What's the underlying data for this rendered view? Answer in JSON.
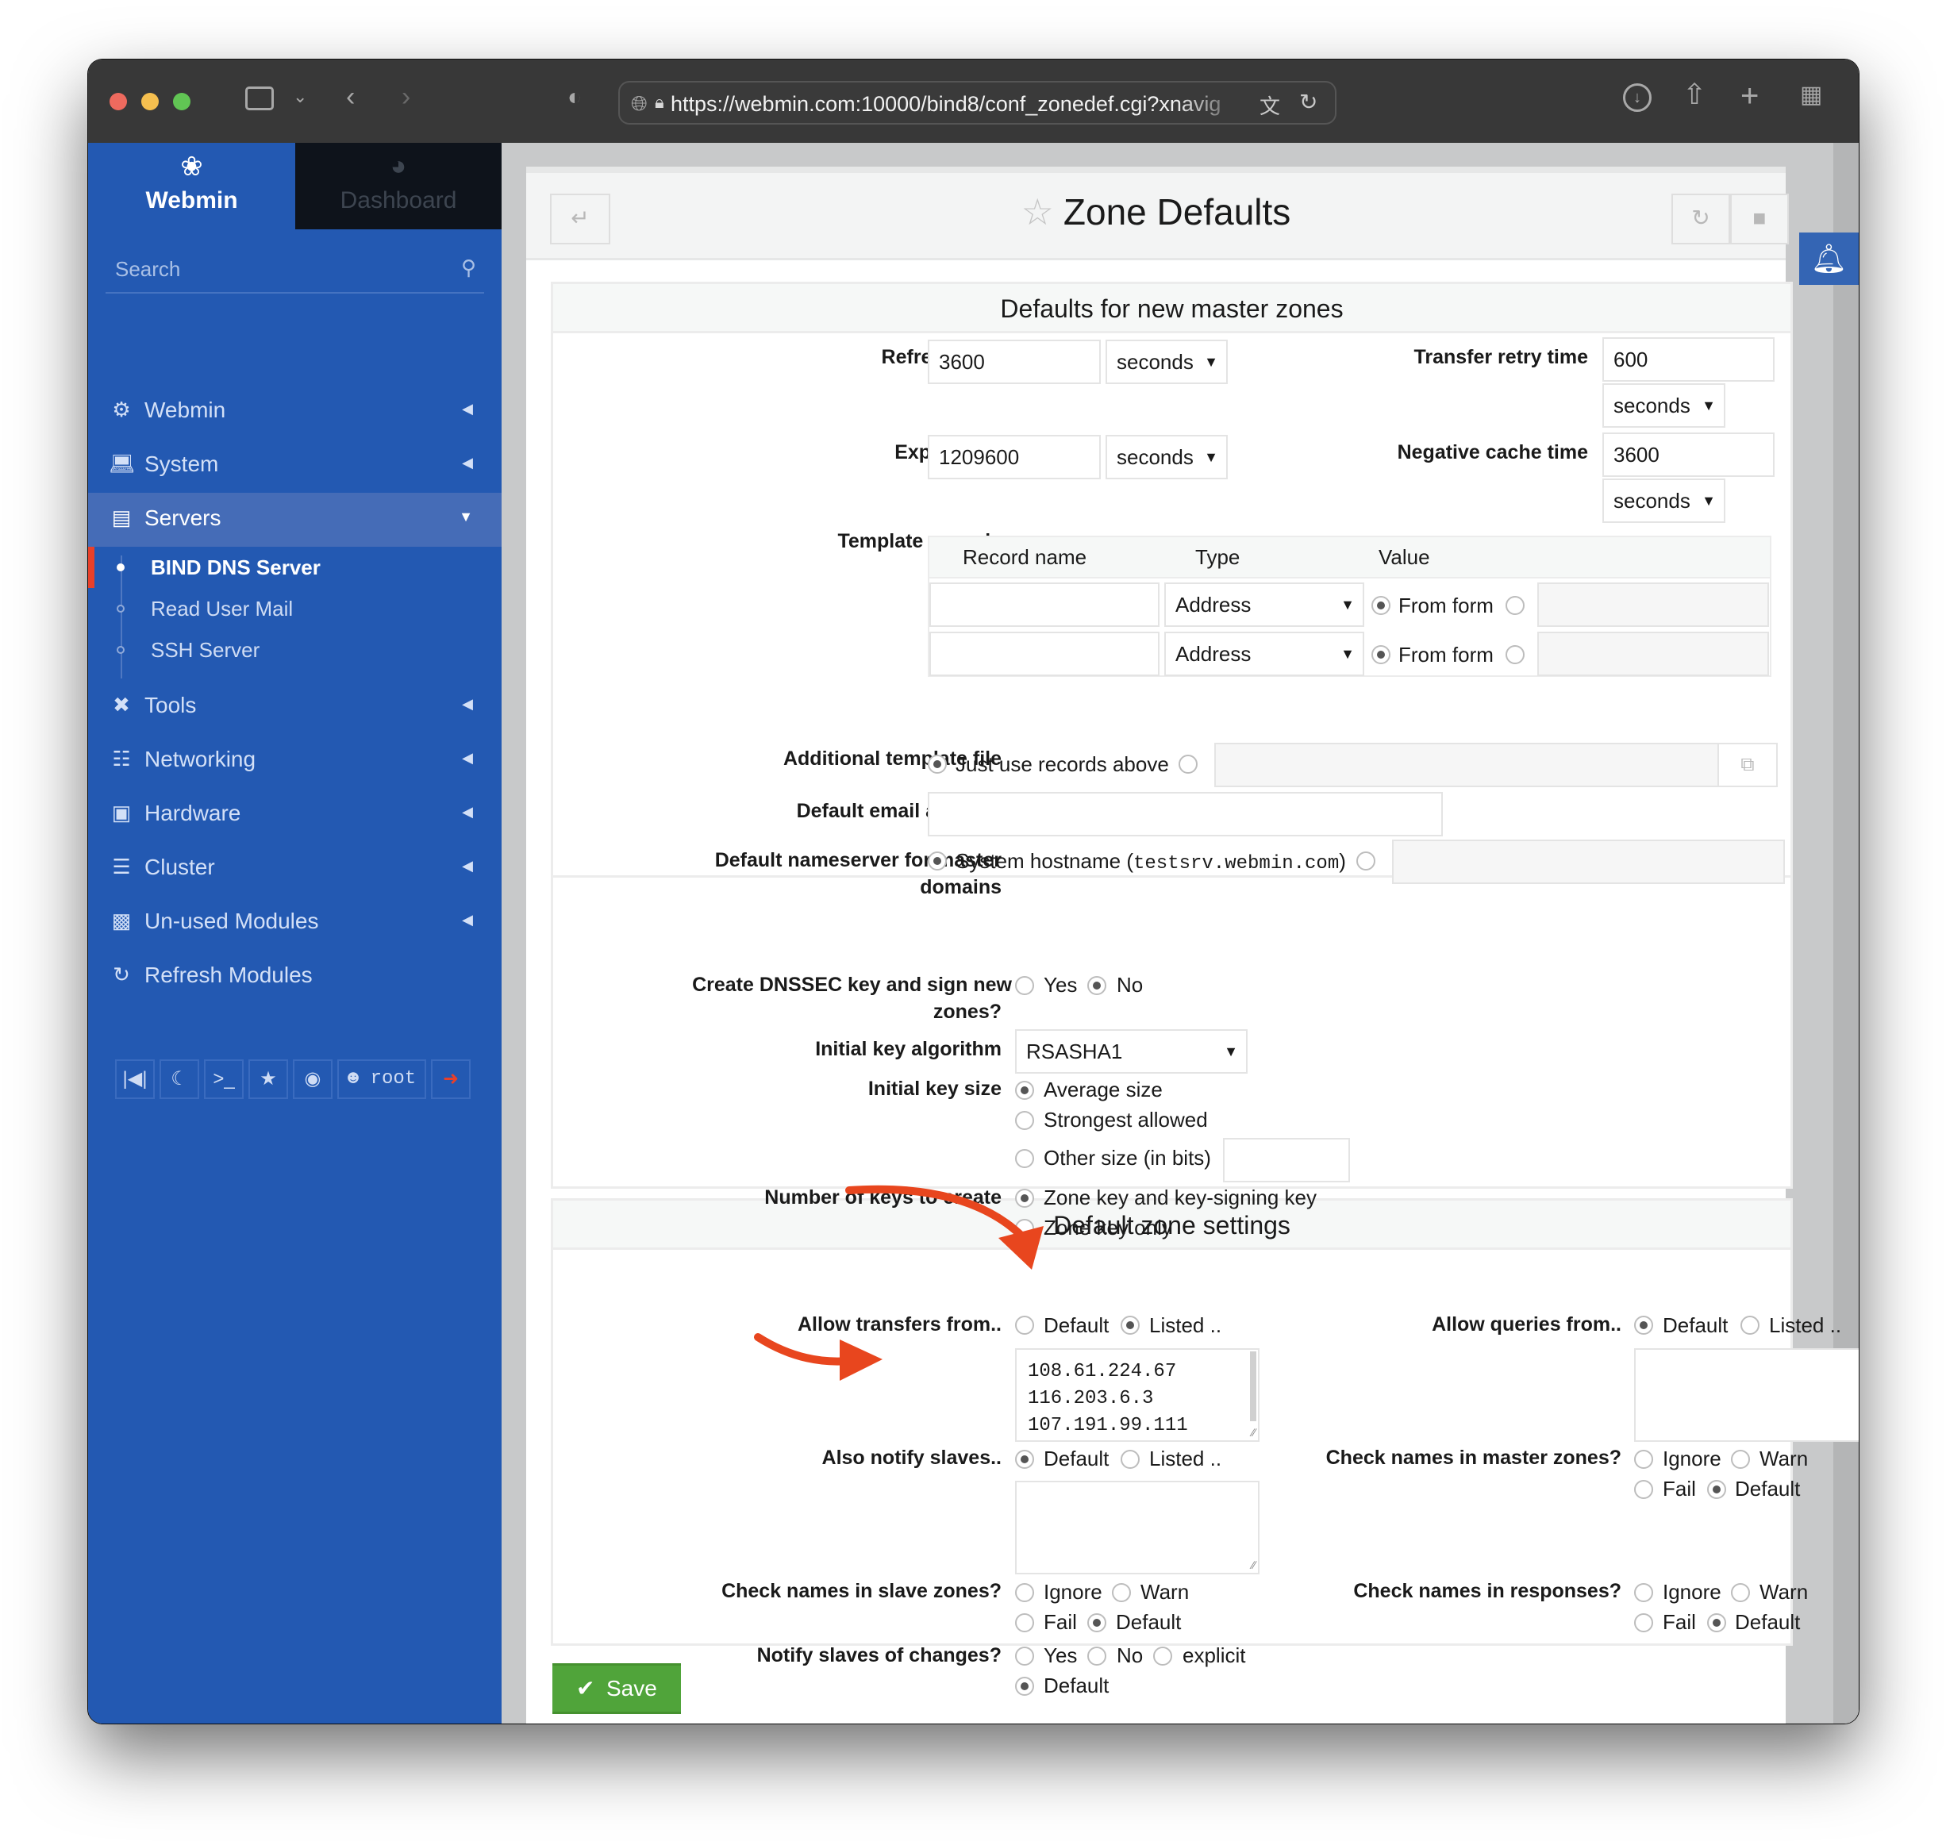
{
  "browser": {
    "url": "https://webmin.com:10000/bind8/conf_zonedef.cgi?xnavig",
    "icons": [
      "sidebar-toggle-icon",
      "chevron-down-icon",
      "back-icon",
      "forward-icon",
      "shield-icon",
      "globe-icon",
      "lock-icon",
      "translate-icon",
      "reload-icon",
      "download-icon",
      "share-icon",
      "new-tab-icon",
      "tab-overview-icon"
    ]
  },
  "sidebar": {
    "tabs": [
      {
        "label": "Webmin",
        "icon": "webmin-logo-icon"
      },
      {
        "label": "Dashboard",
        "icon": "dashboard-gauge-icon"
      }
    ],
    "search_placeholder": "Search",
    "items": [
      {
        "label": "Webmin",
        "icon": "gear-icon",
        "state": "collapsed"
      },
      {
        "label": "System",
        "icon": "laptop-icon",
        "state": "collapsed"
      },
      {
        "label": "Servers",
        "icon": "server-icon",
        "state": "expanded"
      },
      {
        "label": "Tools",
        "icon": "tools-icon",
        "state": "collapsed"
      },
      {
        "label": "Networking",
        "icon": "network-icon",
        "state": "collapsed"
      },
      {
        "label": "Hardware",
        "icon": "hard-drive-icon",
        "state": "collapsed"
      },
      {
        "label": "Cluster",
        "icon": "layers-icon",
        "state": "collapsed"
      },
      {
        "label": "Un-used Modules",
        "icon": "puzzle-icon",
        "state": "collapsed"
      },
      {
        "label": "Refresh Modules",
        "icon": "refresh-icon",
        "state": "none"
      }
    ],
    "sub_items": [
      {
        "label": "BIND DNS Server",
        "active": true
      },
      {
        "label": "Read User Mail",
        "active": false
      },
      {
        "label": "SSH Server",
        "active": false
      }
    ],
    "bottom_bar": {
      "user": "root",
      "buttons": [
        "collapse-sidebar-icon",
        "night-mode-icon",
        "terminal-icon",
        "favorites-star-icon",
        "palette-icon",
        "user-settings-icon",
        "logout-icon"
      ]
    }
  },
  "header": {
    "title": "Zone Defaults",
    "back_icon": "return-arrow-icon",
    "right_icons": [
      "refresh-icon",
      "stop-icon"
    ]
  },
  "master_section": {
    "title": "Defaults for new master zones",
    "refresh_time": {
      "label": "Refresh time",
      "value": "3600",
      "unit": "seconds"
    },
    "transfer_retry_time": {
      "label": "Transfer retry time",
      "value": "600",
      "unit": "seconds"
    },
    "expiry_time": {
      "label": "Expiry time",
      "value": "1209600",
      "unit": "seconds"
    },
    "negative_cache_time": {
      "label": "Negative cache time",
      "value": "3600",
      "unit": "seconds"
    },
    "template_records": {
      "label": "Template records",
      "columns": [
        "Record name",
        "Type",
        "Value"
      ],
      "rows": [
        {
          "name": "",
          "type": "Address",
          "value_mode": "From form",
          "value": ""
        },
        {
          "name": "",
          "type": "Address",
          "value_mode": "From form",
          "value": ""
        }
      ]
    },
    "additional_template_file": {
      "label": "Additional template file",
      "option": "Just use records above",
      "selected": "Just use records above",
      "value": ""
    },
    "default_email": {
      "label": "Default email address",
      "value": ""
    },
    "default_nameserver": {
      "label_1": "Default nameserver for master",
      "label_2": "domains",
      "option_prefix": "System hostname (",
      "hostname": "testsrv.webmin.com",
      "option_suffix": ")",
      "selected": "System hostname",
      "value": ""
    },
    "dnssec": {
      "label_1": "Create DNSSEC key and sign new",
      "label_2": "zones?",
      "options": [
        "Yes",
        "No"
      ],
      "selected": "No"
    },
    "key_algorithm": {
      "label": "Initial key algorithm",
      "value": "RSASHA1"
    },
    "key_size": {
      "label": "Initial key size",
      "options": [
        "Average size",
        "Strongest allowed",
        "Other size (in bits)"
      ],
      "selected": "Average size",
      "other_value": ""
    },
    "num_keys": {
      "label": "Number of keys to create",
      "options": [
        "Zone key and key-signing key",
        "Zone key only"
      ],
      "selected": "Zone key and key-signing key"
    }
  },
  "zone_section": {
    "title": "Default zone settings",
    "allow_transfers": {
      "label": "Allow transfers from..",
      "options": [
        "Default",
        "Listed .."
      ],
      "selected": "Listed ..",
      "list": [
        "108.61.224.67",
        "116.203.6.3",
        "107.191.99.111"
      ]
    },
    "allow_queries": {
      "label": "Allow queries from..",
      "options": [
        "Default",
        "Listed .."
      ],
      "selected": "Default",
      "list": []
    },
    "also_notify": {
      "label": "Also notify slaves..",
      "options": [
        "Default",
        "Listed .."
      ],
      "selected": "Default",
      "list": []
    },
    "check_master": {
      "label": "Check names in master zones?",
      "options": [
        "Ignore",
        "Warn",
        "Fail",
        "Default"
      ],
      "selected": "Default"
    },
    "check_slave": {
      "label": "Check names in slave zones?",
      "options": [
        "Ignore",
        "Warn",
        "Fail",
        "Default"
      ],
      "selected": "Default"
    },
    "check_responses": {
      "label": "Check names in responses?",
      "options": [
        "Ignore",
        "Warn",
        "Fail",
        "Default"
      ],
      "selected": "Default"
    },
    "notify_changes": {
      "label": "Notify slaves of changes?",
      "options": [
        "Yes",
        "No",
        "explicit",
        "Default"
      ],
      "selected": "Default"
    }
  },
  "actions": {
    "save_label": "Save"
  },
  "annotations": {
    "arrow_color": "#e8461e",
    "count": 2
  },
  "colors": {
    "sidebar": "#2359b2",
    "save": "#50a43a",
    "accent_red": "#e8402a"
  }
}
